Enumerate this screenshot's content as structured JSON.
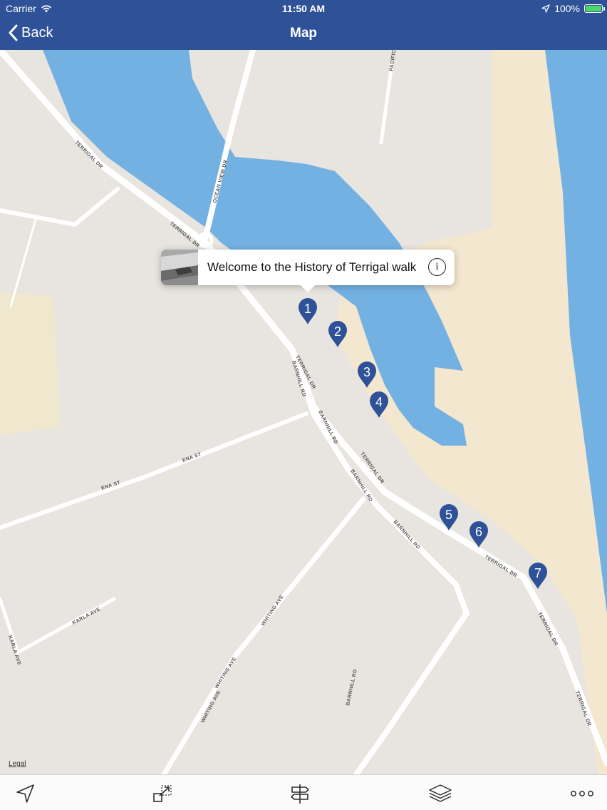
{
  "status_bar": {
    "carrier": "Carrier",
    "time": "11:50 AM",
    "battery": "100%",
    "icons": [
      "wifi-icon",
      "location-arrow-icon",
      "battery-icon"
    ]
  },
  "nav": {
    "back_label": "Back",
    "title": "Map",
    "background_color": "#2e5197"
  },
  "map": {
    "road_labels": {
      "terrigal_dr_1": "TERRIGAL DR",
      "terrigal_dr_2": "TERRIGAL DR",
      "terrigal_dr_3": "TERRIGAL DR",
      "terrigal_dr_4": "TERRIGAL DR",
      "terrigal_dr_5": "TERRIGAL DR",
      "terrigal_dr_6": "TERRIGAL DR",
      "terrigal_dr_7": "TERRIGAL DR",
      "ocean_view_dr": "OCEAN VIEW DR",
      "pacific": "PACIFIC",
      "barnhill_rd_1": "BARNHILL RD",
      "barnhill_rd_2": "BARNHILL RD",
      "barnhill_rd_3": "BARNHILL RD",
      "barnhill_rd_4": "BARNHILL RD",
      "barnhill_rd_5": "BARNHILL RD",
      "ena_st_1": "ENA ST",
      "ena_st_2": "ENA ST",
      "whiting_ave_1": "WHITING AVE",
      "whiting_ave_2": "WHITING AVE",
      "whiting_ave_3": "WHITING AVE",
      "karla_ave_1": "KARLA AVE",
      "karla_ave_2": "KARLA AVE"
    },
    "legal_label": "Legal",
    "pins": [
      "1",
      "2",
      "3",
      "4",
      "5",
      "6",
      "7"
    ],
    "pin_color": "#2e5197",
    "water_color": "#74b1e3",
    "sand_color": "#f3e7cf",
    "callout": {
      "title": "Welcome to the History of Terrigal walk",
      "info_glyph": "i"
    }
  },
  "toolbar": {
    "items": [
      "location-arrow-icon",
      "expand-icon",
      "signpost-icon",
      "layers-icon",
      "more-icon"
    ]
  }
}
